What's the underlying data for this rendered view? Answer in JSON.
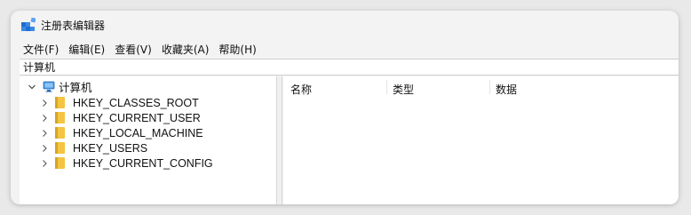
{
  "window": {
    "title": "注册表编辑器",
    "icon": "registry-editor-icon"
  },
  "menu": [
    {
      "label": "文件(F)"
    },
    {
      "label": "编辑(E)"
    },
    {
      "label": "查看(V)"
    },
    {
      "label": "收藏夹(A)"
    },
    {
      "label": "帮助(H)"
    }
  ],
  "address": {
    "value": "计算机"
  },
  "tree": {
    "root": {
      "label": "计算机",
      "expanded": true,
      "icon": "computer-icon"
    },
    "children": [
      {
        "label": "HKEY_CLASSES_ROOT",
        "icon": "folder-icon"
      },
      {
        "label": "HKEY_CURRENT_USER",
        "icon": "folder-icon"
      },
      {
        "label": "HKEY_LOCAL_MACHINE",
        "icon": "folder-icon"
      },
      {
        "label": "HKEY_USERS",
        "icon": "folder-icon"
      },
      {
        "label": "HKEY_CURRENT_CONFIG",
        "icon": "folder-icon"
      }
    ]
  },
  "list": {
    "columns": [
      {
        "label": "名称"
      },
      {
        "label": "类型"
      },
      {
        "label": "数据"
      }
    ]
  },
  "colors": {
    "folder": "#f4c542",
    "window_bg": "#f3f3f3",
    "pane_bg": "#ffffff",
    "accent": "#2b7bd6"
  }
}
